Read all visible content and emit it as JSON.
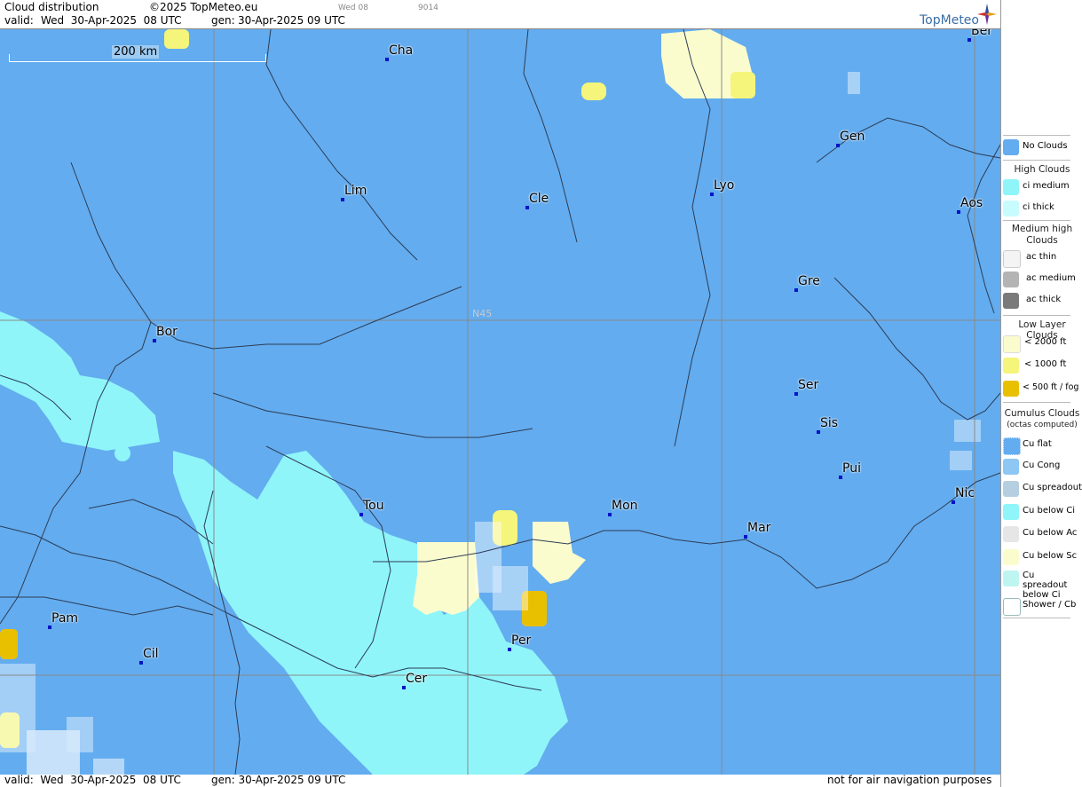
{
  "header": {
    "title": "Cloud distribution",
    "copyright": "©2025 TopMeteo.eu",
    "valid_label": "valid:",
    "valid_value": "Wed  30-Apr-2025  08 UTC",
    "gen_label": "gen:",
    "gen_value": "30-Apr-2025 09 UTC",
    "frame_day": "Wed 08",
    "frame_code": "9014",
    "logo": "TopMeteo"
  },
  "footer": {
    "valid": "valid:  Wed  30-Apr-2025  08 UTC",
    "gen": "gen: 30-Apr-2025 09 UTC",
    "disclaimer": "not for air navigation purposes"
  },
  "map": {
    "scale_label": "200 km",
    "lat_label": "N45",
    "colors": {
      "no_clouds": "#63acef",
      "ci_medium": "#8ff5f9",
      "low_2000": "#fbfcce",
      "low_1000": "#f4f57a",
      "low_500": "#e9c000",
      "city_dot": "#0014c8"
    },
    "cities": [
      {
        "name": "Cha"
      },
      {
        "name": "Ber"
      },
      {
        "name": "Gen"
      },
      {
        "name": "Lim"
      },
      {
        "name": "Cle"
      },
      {
        "name": "Lyo"
      },
      {
        "name": "Aos"
      },
      {
        "name": "Gre"
      },
      {
        "name": "Bor"
      },
      {
        "name": "Ser"
      },
      {
        "name": "Sis"
      },
      {
        "name": "Pui"
      },
      {
        "name": "Tou"
      },
      {
        "name": "Mon"
      },
      {
        "name": "Mar"
      },
      {
        "name": "Nic"
      },
      {
        "name": "Pam"
      },
      {
        "name": "Cil"
      },
      {
        "name": "Per"
      },
      {
        "name": "Cer"
      }
    ]
  },
  "legend": {
    "no_clouds": "No Clouds",
    "high_clouds": "High Clouds",
    "ci_medium": "ci medium",
    "ci_thick": "ci thick",
    "medium_high": "Medium high Clouds",
    "ac_thin": "ac thin",
    "ac_medium": "ac medium",
    "ac_thick": "ac thick",
    "low_layer": "Low Layer Clouds",
    "low_2000": "< 2000 ft",
    "low_1000": "< 1000 ft",
    "low_500": "< 500 ft / fog",
    "cumulus": "Cumulus Clouds",
    "cumulus_sub": "(octas computed)",
    "cu_flat": "Cu flat",
    "cu_cong": "Cu Cong",
    "cu_spreadout": "Cu spreadout",
    "cu_below_ci": "Cu below Ci",
    "cu_below_ac": "Cu below Ac",
    "cu_below_sc": "Cu below Sc",
    "cu_spreadout_below_ci": "Cu spreadout below Ci",
    "shower_cb": "Shower / Cb"
  }
}
